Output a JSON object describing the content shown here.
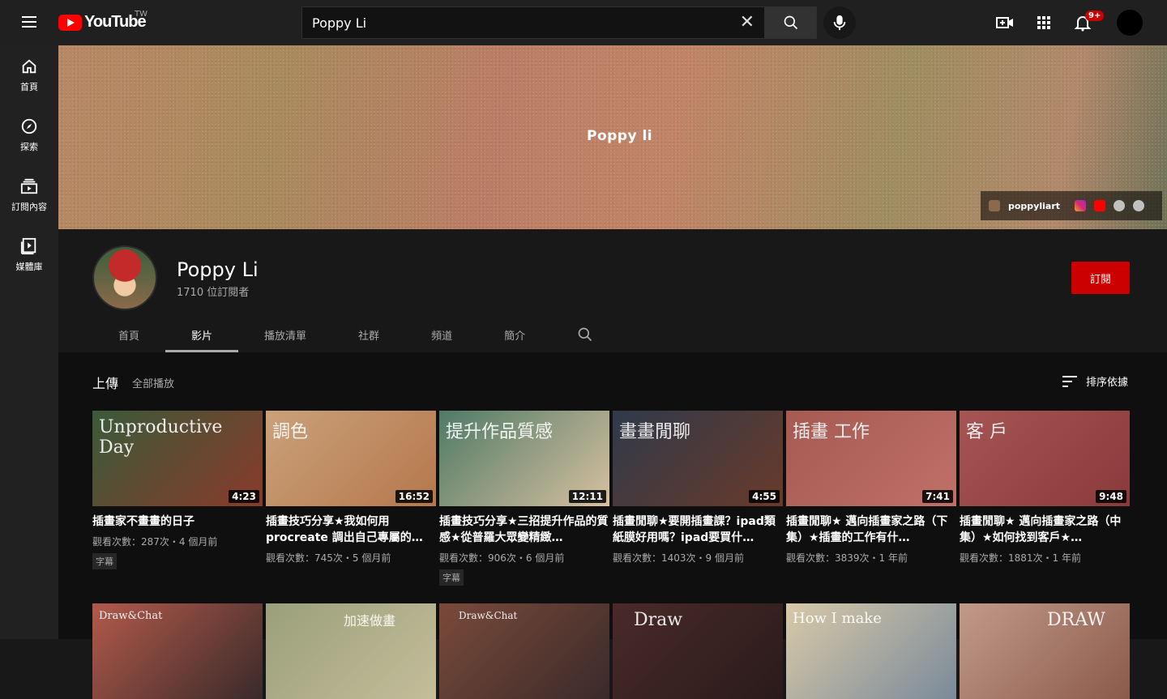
{
  "topbar": {
    "logo_text": "YouTube",
    "region": "TW",
    "search_value": "Poppy Li",
    "notification_badge": "9+"
  },
  "sidebar": {
    "items": [
      {
        "label": "首頁",
        "icon": "home-icon"
      },
      {
        "label": "探索",
        "icon": "explore-icon"
      },
      {
        "label": "訂閱內容",
        "icon": "subscriptions-icon"
      },
      {
        "label": "媒體庫",
        "icon": "library-icon"
      }
    ]
  },
  "banner": {
    "title": "Poppy li",
    "link_name": "poppyliart"
  },
  "channel": {
    "name": "Poppy Li",
    "subscribers": "1710 位訂閱者",
    "subscribe_label": "訂閱",
    "tabs": [
      {
        "label": "首頁"
      },
      {
        "label": "影片"
      },
      {
        "label": "播放清單"
      },
      {
        "label": "社群"
      },
      {
        "label": "頻道"
      },
      {
        "label": "簡介"
      }
    ],
    "active_tab": "影片"
  },
  "section": {
    "title": "上傳",
    "play_all": "全部播放",
    "sort_label": "排序依據"
  },
  "videos": [
    {
      "thumb_text": "Unproductive Day",
      "duration": "4:23",
      "title": "插畫家不畫畫的日子",
      "meta": "觀看次數：287次・4 個月前",
      "cc": "字幕",
      "color": "#3a5a3a"
    },
    {
      "thumb_text": "調色",
      "duration": "16:52",
      "title": "插畫技巧分享★我如何用procreate 調出自己專屬的…",
      "meta": "觀看次數：745次・5 個月前",
      "cc": "",
      "color": "#caa17a"
    },
    {
      "thumb_text": "提升作品質感",
      "duration": "12:11",
      "title": "插畫技巧分享★三招提升作品的質感★從普羅大眾變精緻…",
      "meta": "觀看次數：906次・6 個月前",
      "cc": "字幕",
      "color": "#4f7a66"
    },
    {
      "thumb_text": "畫畫閒聊",
      "duration": "4:55",
      "title": "插畫閒聊★要開插畫課？ipad類紙膜好用嗎？ipad要買什…",
      "meta": "觀看次數：1403次・9 個月前",
      "cc": "",
      "color": "#2f3a4a"
    },
    {
      "thumb_text": "插畫 工作",
      "duration": "7:41",
      "title": "插畫閒聊★ 邁向插畫家之路（下集）★插畫的工作有什…",
      "meta": "觀看次數：3839次・1 年前",
      "cc": "",
      "color": "#a55a52"
    },
    {
      "thumb_text": "客 戶",
      "duration": "9:48",
      "title": "插畫閒聊★ 邁向插畫家之路（中集）★如何找到客戶★…",
      "meta": "觀看次數：1881次・1 年前",
      "cc": "",
      "color": "#a65454"
    }
  ],
  "videos_row2": [
    {
      "thumb_text": "Draw&Chat",
      "color": "#b25a4a"
    },
    {
      "thumb_text": "加速做畫",
      "color": "#9aa07a"
    },
    {
      "thumb_text": "Draw&Chat",
      "color": "#7a4a3a"
    },
    {
      "thumb_text": "Draw",
      "color": "#4a2a2a"
    },
    {
      "thumb_text": "How I make",
      "color": "#d8c9a8"
    },
    {
      "thumb_text": "DRAW",
      "color": "#c29a8a"
    }
  ]
}
